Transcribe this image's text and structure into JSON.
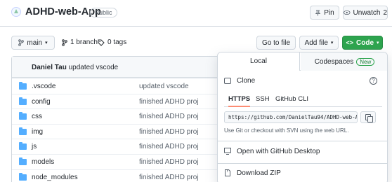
{
  "repo": {
    "name": "ADHD-web-App",
    "visibility": "Public"
  },
  "header_actions": {
    "pin": "Pin",
    "unwatch": "Unwatch",
    "watch_count": "2"
  },
  "branch": {
    "name": "main",
    "branches": "1 branch",
    "tags": "0 tags"
  },
  "toolbar": {
    "goto_file": "Go to file",
    "add_file": "Add file",
    "code": "Code"
  },
  "commit": {
    "author": "Daniel Tau",
    "message": "updated vscode"
  },
  "files": [
    {
      "name": ".vscode",
      "message": "updated vscode"
    },
    {
      "name": "config",
      "message": "finished ADHD proj"
    },
    {
      "name": "css",
      "message": "finished ADHD proj"
    },
    {
      "name": "img",
      "message": "finished ADHD proj"
    },
    {
      "name": "js",
      "message": "finished ADHD proj"
    },
    {
      "name": "models",
      "message": "finished ADHD proj"
    },
    {
      "name": "node_modules",
      "message": "finished ADHD proj"
    }
  ],
  "dropdown": {
    "tab_local": "Local",
    "tab_codespaces": "Codespaces",
    "new_badge": "New",
    "clone_title": "Clone",
    "protocols": [
      "HTTPS",
      "SSH",
      "GitHub CLI"
    ],
    "clone_url": "https://github.com/DanielTau94/ADHD-web-App.git",
    "hint": "Use Git or checkout with SVN using the web URL.",
    "open_desktop": "Open with GitHub Desktop",
    "download_zip": "Download ZIP"
  },
  "colors": {
    "accent_green": "#2da44e",
    "folder_blue": "#54aeff",
    "tab_underline": "#fd8c73"
  }
}
